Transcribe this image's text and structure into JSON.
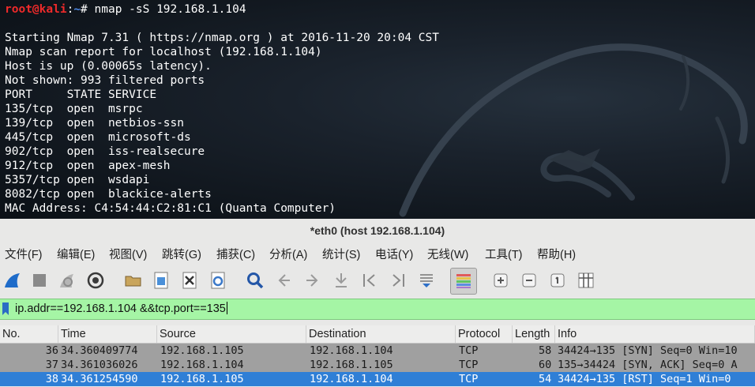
{
  "terminal": {
    "prompt": {
      "user": "root",
      "at": "@",
      "host": "kali",
      "sep": ":",
      "path": "~",
      "symbol": "#"
    },
    "command": " nmap -sS 192.168.1.104",
    "output": [
      "Starting Nmap 7.31 ( https://nmap.org ) at 2016-11-20 20:04 CST",
      "Nmap scan report for localhost (192.168.1.104)",
      "Host is up (0.00065s latency).",
      "Not shown: 993 filtered ports",
      "PORT     STATE SERVICE",
      "135/tcp  open  msrpc",
      "139/tcp  open  netbios-ssn",
      "445/tcp  open  microsoft-ds",
      "902/tcp  open  iss-realsecure",
      "912/tcp  open  apex-mesh",
      "5357/tcp open  wsdapi",
      "8082/tcp open  blackice-alerts",
      "MAC Address: C4:54:44:C2:81:C1 (Quanta Computer)"
    ]
  },
  "wireshark": {
    "title": "*eth0 (host 192.168.1.104)",
    "menu": [
      "文件(F)",
      "编辑(E)",
      "视图(V)",
      "跳转(G)",
      "捕获(C)",
      "分析(A)",
      "统计(S)",
      "电话(Y)",
      "无线(W)",
      "工具(T)",
      "帮助(H)"
    ],
    "toolbar_icons": [
      "shark-fin-start-icon",
      "stop-square-icon",
      "restart-fin-icon",
      "capture-options-gear-icon",
      "open-folder-icon",
      "save-file-icon",
      "close-file-icon",
      "reload-file-icon",
      "find-packet-icon",
      "go-back-icon",
      "go-forward-icon",
      "go-to-packet-icon",
      "first-packet-icon",
      "last-packet-icon",
      "autoscroll-icon",
      "colorize-icon",
      "zoom-in-icon",
      "zoom-out-icon",
      "normal-size-icon",
      "resize-columns-icon"
    ],
    "filter": {
      "value": "ip.addr==192.168.1.104 &&tcp.port==135"
    },
    "columns": [
      "No.",
      "Time",
      "Source",
      "Destination",
      "Protocol",
      "Length",
      "Info"
    ],
    "packets": [
      {
        "no": "36",
        "time": "34.360409774",
        "src": "192.168.1.105",
        "dst": "192.168.1.104",
        "proto": "TCP",
        "len": "58",
        "info": "34424→135 [SYN] Seq=0 Win=10"
      },
      {
        "no": "37",
        "time": "34.361036026",
        "src": "192.168.1.104",
        "dst": "192.168.1.105",
        "proto": "TCP",
        "len": "60",
        "info": "135→34424 [SYN, ACK] Seq=0 A"
      },
      {
        "no": "38",
        "time": "34.361254590",
        "src": "192.168.1.105",
        "dst": "192.168.1.104",
        "proto": "TCP",
        "len": "54",
        "info": "34424→135 [RST] Seq=1 Win=0"
      }
    ]
  }
}
